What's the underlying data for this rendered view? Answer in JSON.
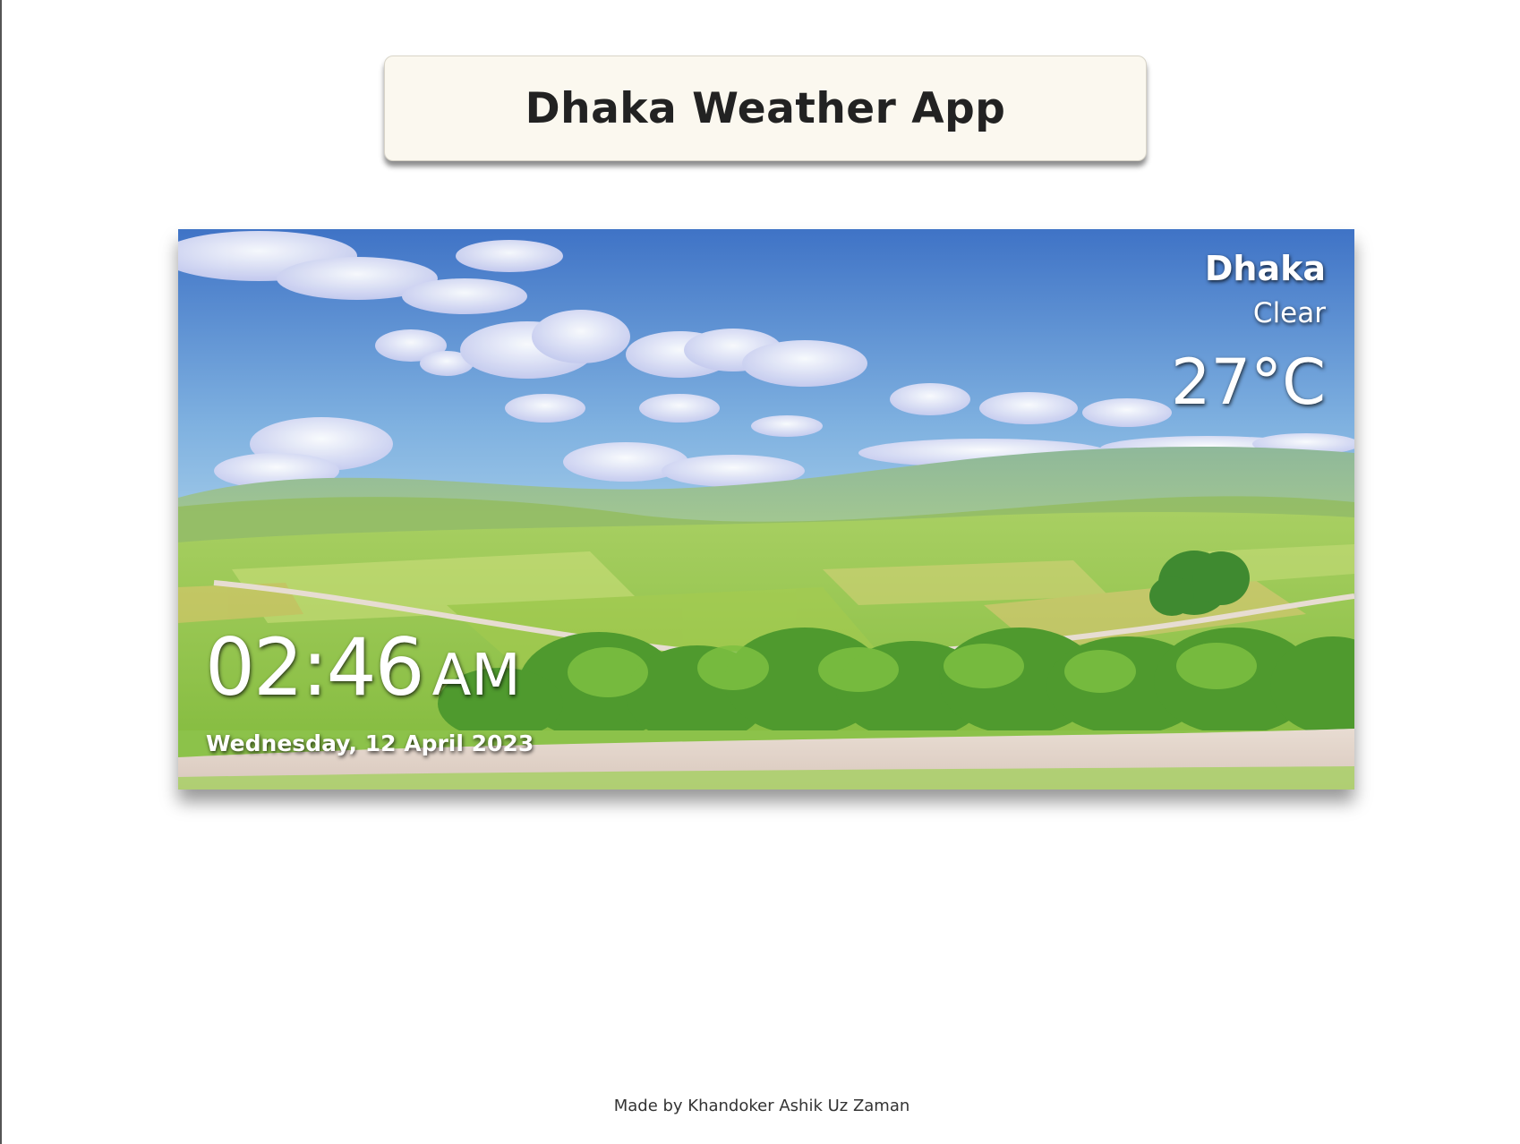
{
  "header": {
    "title": "Dhaka Weather App"
  },
  "weather": {
    "city": "Dhaka",
    "condition": "Clear",
    "temperature": "27°C",
    "time": "02:46",
    "ampm": "AM",
    "date": "Wednesday, 12 April 2023"
  },
  "footer": {
    "credit": "Made by Khandoker Ashik Uz Zaman"
  },
  "colors": {
    "title_background": "#fbf8ef",
    "title_text": "#222222",
    "overlay_text": "#ffffff"
  },
  "background_image": {
    "icon": "countryside-landscape-illustration"
  }
}
